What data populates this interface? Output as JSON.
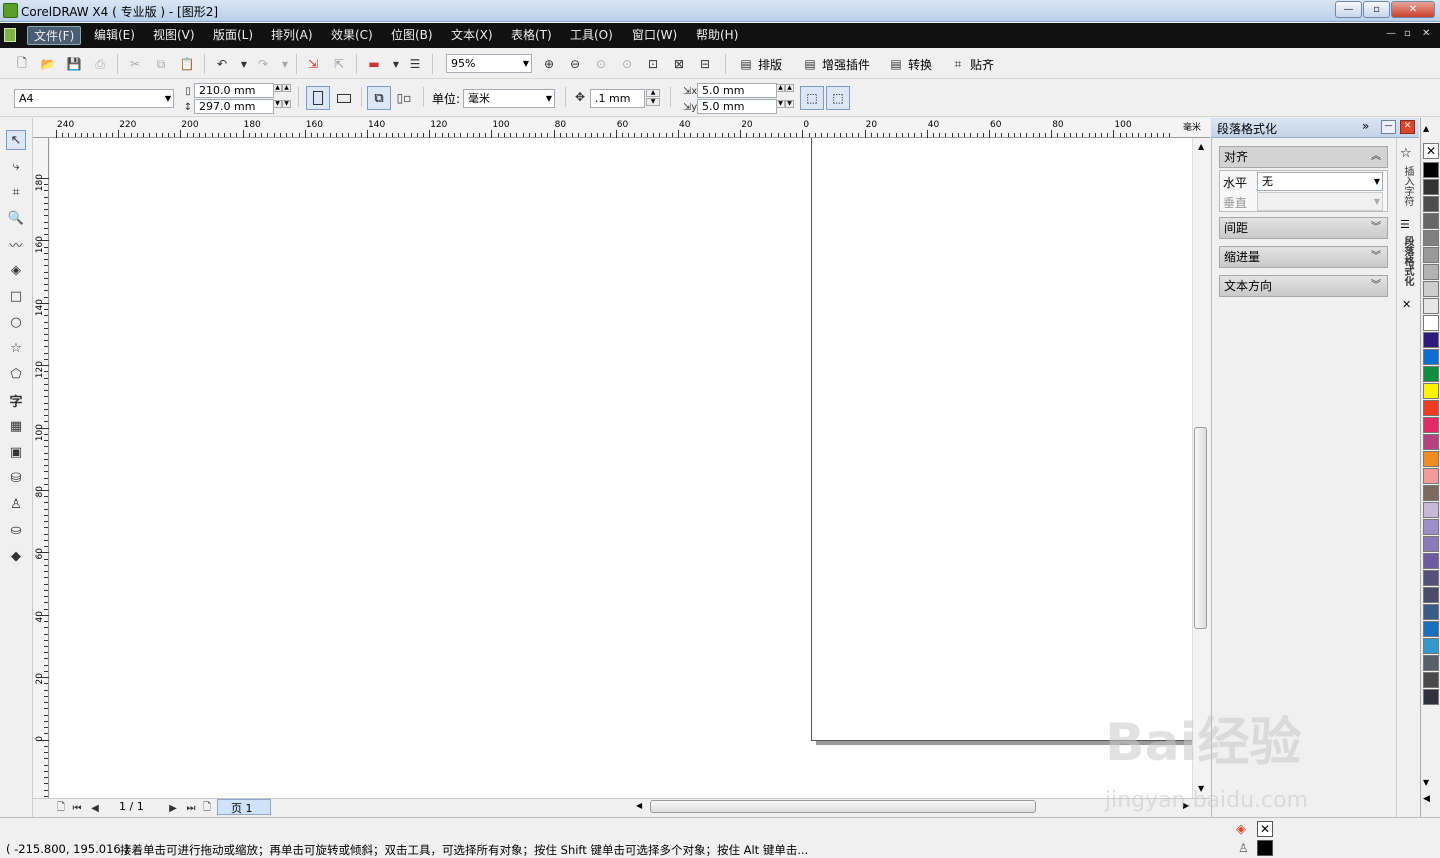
{
  "window": {
    "title": "CorelDRAW X4 ( 专业版 ) - [图形2]",
    "min": "—",
    "max": "▫",
    "close": "✕"
  },
  "menu": [
    "文件(F)",
    "编辑(E)",
    "视图(V)",
    "版面(L)",
    "排列(A)",
    "效果(C)",
    "位图(B)",
    "文本(X)",
    "表格(T)",
    "工具(O)",
    "窗口(W)",
    "帮助(H)"
  ],
  "toolbar": {
    "zoom": "95%",
    "layout_label": "排版",
    "plugin_label": "增强插件",
    "convert_label": "转换",
    "snap_label": "贴齐"
  },
  "property_bar": {
    "paper": "A4",
    "width": "210.0 mm",
    "height": "297.0 mm",
    "unit_label": "单位:",
    "unit": "毫米",
    "nudge": ".1 mm",
    "dup_x": "5.0 mm",
    "dup_y": "5.0 mm"
  },
  "ruler": {
    "h_labels": [
      "240",
      "220",
      "200",
      "180",
      "160",
      "140",
      "120",
      "100",
      "80",
      "60",
      "40",
      "20",
      "0",
      "20",
      "40",
      "60",
      "80",
      "100"
    ],
    "h_unit": "毫米",
    "v_labels": [
      "180",
      "160",
      "140",
      "120",
      "100",
      "80",
      "60",
      "40",
      "20",
      "0"
    ]
  },
  "pagebar": {
    "page_count": "1 / 1",
    "page_tab": "页 1"
  },
  "docker": {
    "title": "段落格式化",
    "sections": {
      "align": "对齐",
      "horizontal_label": "水平",
      "horizontal_value": "无",
      "vertical_label": "垂直",
      "spacing": "间距",
      "indent": "缩进量",
      "direction": "文本方向"
    },
    "tab_insert": "插入字符",
    "tab_para": "段落格式化"
  },
  "palette": [
    "#000000",
    "#333333",
    "#4d4d4d",
    "#666666",
    "#808080",
    "#999999",
    "#b3b3b3",
    "#cccccc",
    "#e6e6e6",
    "#ffffff",
    "#2e1a7a",
    "#0a6fd4",
    "#0c8f3e",
    "#fff200",
    "#ef3b23",
    "#e22a68",
    "#b7407f",
    "#f28c1f",
    "#f39a9a",
    "#7d6a5e",
    "#c8b8d8",
    "#9c8ec8",
    "#8b7bb8",
    "#6d5aa0",
    "#55507a",
    "#4a4a6a",
    "#3a5a8a",
    "#1a6fbf",
    "#3399cc",
    "#55606a",
    "#4a4a4a",
    "#303040"
  ],
  "status": {
    "coords": "( -215.800, 195.016 )",
    "message": "接着单击可进行拖动或缩放；再单击可旋转或倾斜；双击工具，可选择所有对象；按住 Shift 键单击可选择多个对象；按住 Alt 键单击..."
  },
  "watermark": {
    "main": "Bai经验",
    "sub": "jingyan.baidu.com"
  }
}
